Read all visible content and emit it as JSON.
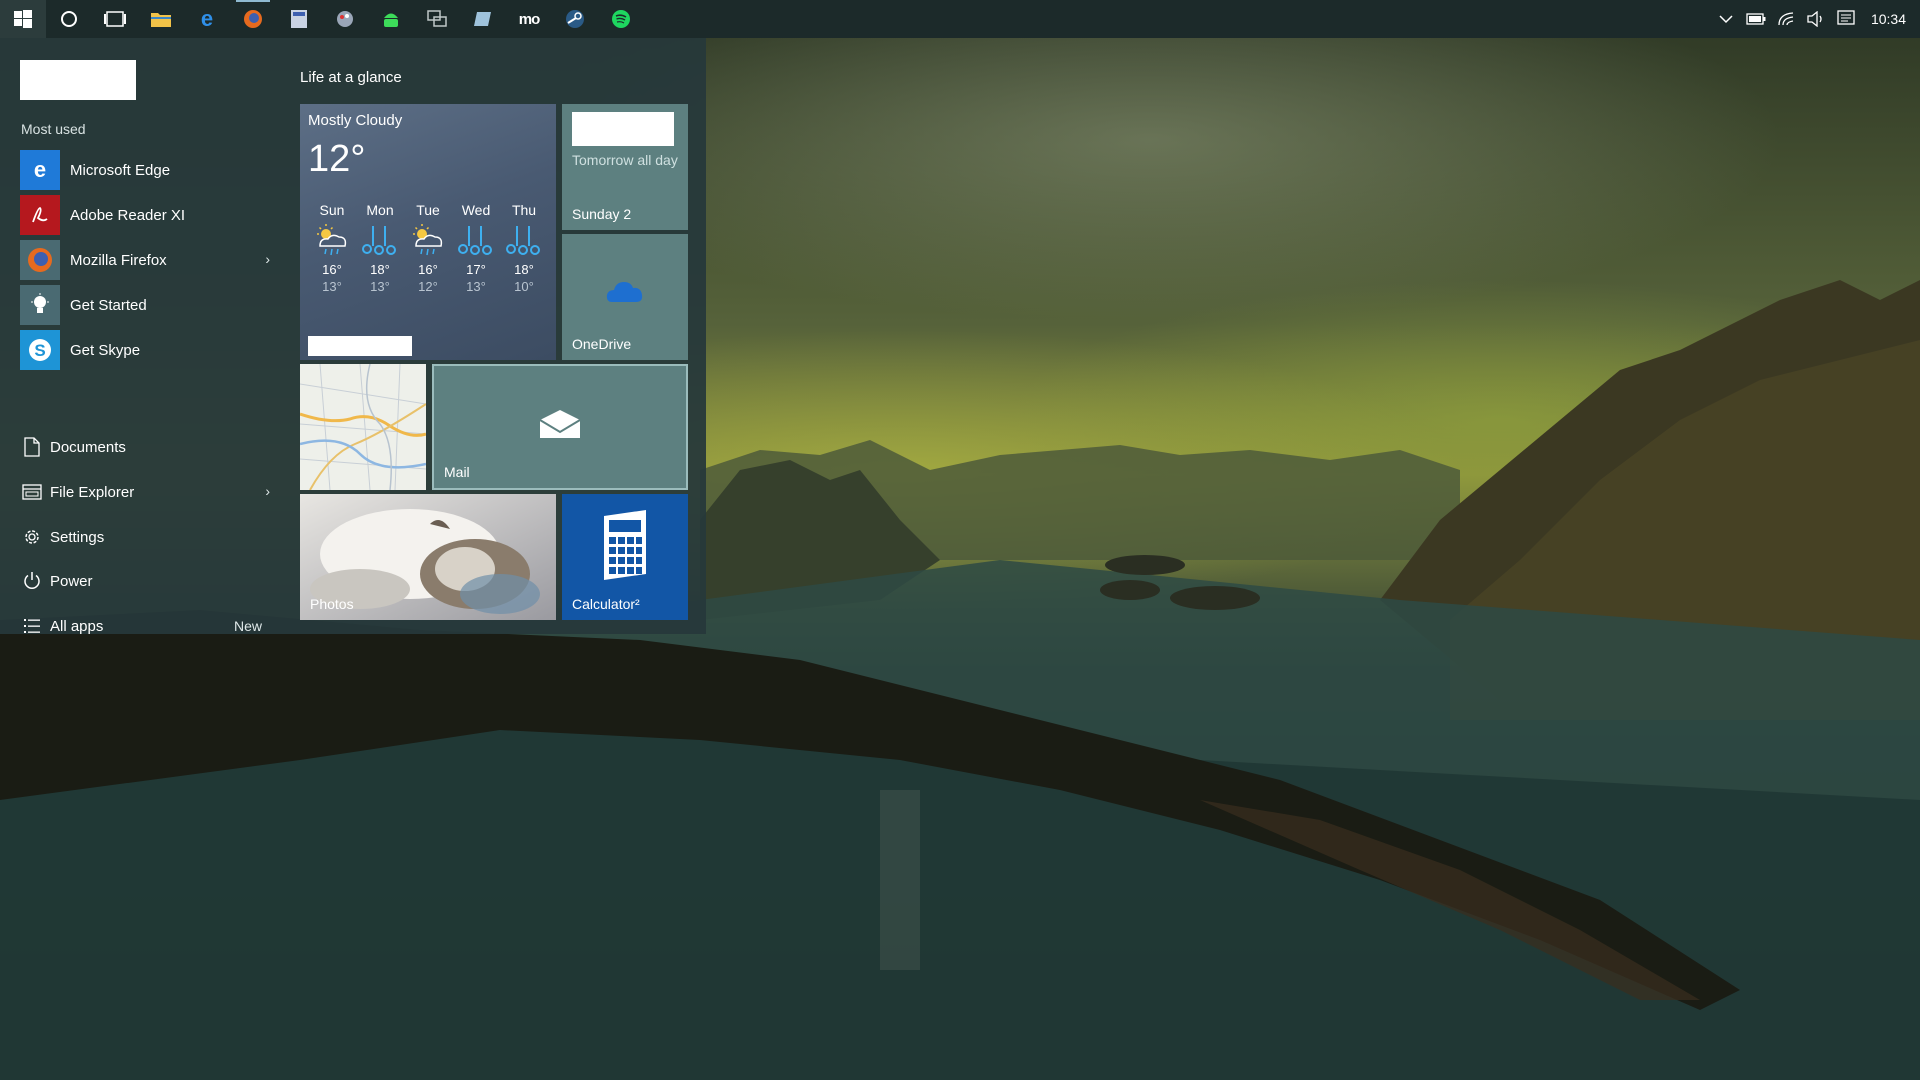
{
  "taskbar": {
    "pinned": [
      {
        "name": "task-view-icon"
      },
      {
        "name": "file-explorer-icon"
      },
      {
        "name": "edge-icon"
      },
      {
        "name": "firefox-icon"
      },
      {
        "name": "calculator-app-icon"
      },
      {
        "name": "paint-icon"
      },
      {
        "name": "android-icon"
      },
      {
        "name": "chat-icon"
      },
      {
        "name": "notes-icon"
      },
      {
        "name": "mo-app-icon",
        "label": "mo"
      },
      {
        "name": "steam-icon"
      },
      {
        "name": "spotify-icon"
      }
    ],
    "clock": "10:34"
  },
  "start_menu": {
    "most_used_label": "Most used",
    "apps": [
      {
        "label": "Microsoft Edge",
        "icon": "edge-icon",
        "color": "#1f7ad8",
        "has_submenu": false
      },
      {
        "label": "Adobe Reader XI",
        "icon": "adobe-reader-icon",
        "color": "#b5181e",
        "has_submenu": false
      },
      {
        "label": "Mozilla Firefox",
        "icon": "firefox-icon",
        "color": "#4a6a72",
        "has_submenu": true
      },
      {
        "label": "Get Started",
        "icon": "lightbulb-icon",
        "color": "#4a6a72",
        "has_submenu": false
      },
      {
        "label": "Get Skype",
        "icon": "skype-icon",
        "color": "#1e94d6",
        "has_submenu": false
      }
    ],
    "nav": [
      {
        "label": "Documents",
        "icon": "document-icon"
      },
      {
        "label": "File Explorer",
        "icon": "folder-icon",
        "has_submenu": true
      },
      {
        "label": "Settings",
        "icon": "gear-icon"
      },
      {
        "label": "Power",
        "icon": "power-icon"
      },
      {
        "label": "All apps",
        "icon": "list-icon",
        "badge": "New"
      }
    ],
    "group_label": "Life at a glance",
    "weather": {
      "condition": "Mostly Cloudy",
      "temperature": "12°",
      "forecast": [
        {
          "day": "Sun",
          "high": "16°",
          "low": "13°",
          "icon": "partly-cloudy-rain-icon"
        },
        {
          "day": "Mon",
          "high": "18°",
          "low": "13°",
          "icon": "rain-icon"
        },
        {
          "day": "Tue",
          "high": "16°",
          "low": "12°",
          "icon": "partly-cloudy-rain-icon"
        },
        {
          "day": "Wed",
          "high": "17°",
          "low": "13°",
          "icon": "rain-icon"
        },
        {
          "day": "Thu",
          "high": "18°",
          "low": "10°",
          "icon": "rain-icon"
        }
      ]
    },
    "calendar": {
      "event_time": "Tomorrow all day",
      "date": "Sunday 2"
    },
    "onedrive": {
      "label": "OneDrive"
    },
    "mail": {
      "label": "Mail"
    },
    "photos": {
      "label": "Photos"
    },
    "calculator": {
      "label": "Calculator²"
    }
  }
}
